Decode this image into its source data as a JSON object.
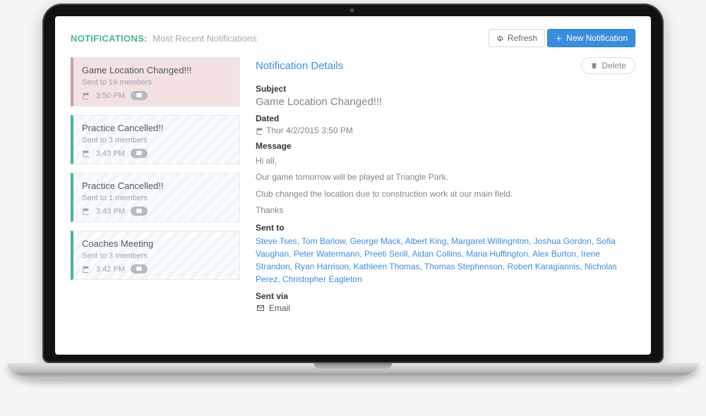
{
  "header": {
    "title": "NOTIFICATIONS:",
    "subtitle": "Most Recent Notifications",
    "refresh_label": "Refresh",
    "new_label": "New Notification"
  },
  "list": [
    {
      "title": "Game Location Changed!!!",
      "meta": "Sent to 19 members",
      "time": "3:50 PM",
      "selected": true
    },
    {
      "title": "Practice Cancelled!!",
      "meta": "Sent to 3 members",
      "time": "3:43 PM",
      "selected": false
    },
    {
      "title": "Practice Cancelled!!",
      "meta": "Sent to 1 members",
      "time": "3:43 PM",
      "selected": false
    },
    {
      "title": "Coaches Meeting",
      "meta": "Sent to 3 members",
      "time": "3:42 PM",
      "selected": false
    }
  ],
  "details": {
    "heading": "Notification Details",
    "delete_label": "Delete",
    "subject_label": "Subject",
    "subject": "Game Location Changed!!!",
    "dated_label": "Dated",
    "dated": "Thur 4/2/2015 3:50 PM",
    "message_label": "Message",
    "message_lines": [
      "Hi all,",
      "Our game tomorrow will be played at Triangle Park.",
      "Club changed the location due to construction work at our main field.",
      "Thanks"
    ],
    "sent_to_label": "Sent to",
    "recipients": [
      "Steve Tses",
      "Tom Barlow",
      "George Mack",
      "Albert King",
      "Margaret Willingnton",
      "Joshua Gordon",
      "Sofia Vaughan",
      "Peter Watermann",
      "Preeti Serill",
      "Aidan Collins",
      "Maria Huffington",
      "Alex Burton",
      "Irene Strandon",
      "Ryan Harrison",
      "Kathleen Thomas",
      "Thomas Stephenson",
      "Robert Karagiannis",
      "Nicholas Perez",
      "Christopher Eagleton"
    ],
    "sent_via_label": "Sent via",
    "sent_via_value": "Email"
  },
  "icons": {
    "refresh": "refresh-icon",
    "plus": "plus-icon",
    "trash": "trash-icon",
    "calendar": "calendar-icon",
    "envelope": "envelope-icon"
  }
}
